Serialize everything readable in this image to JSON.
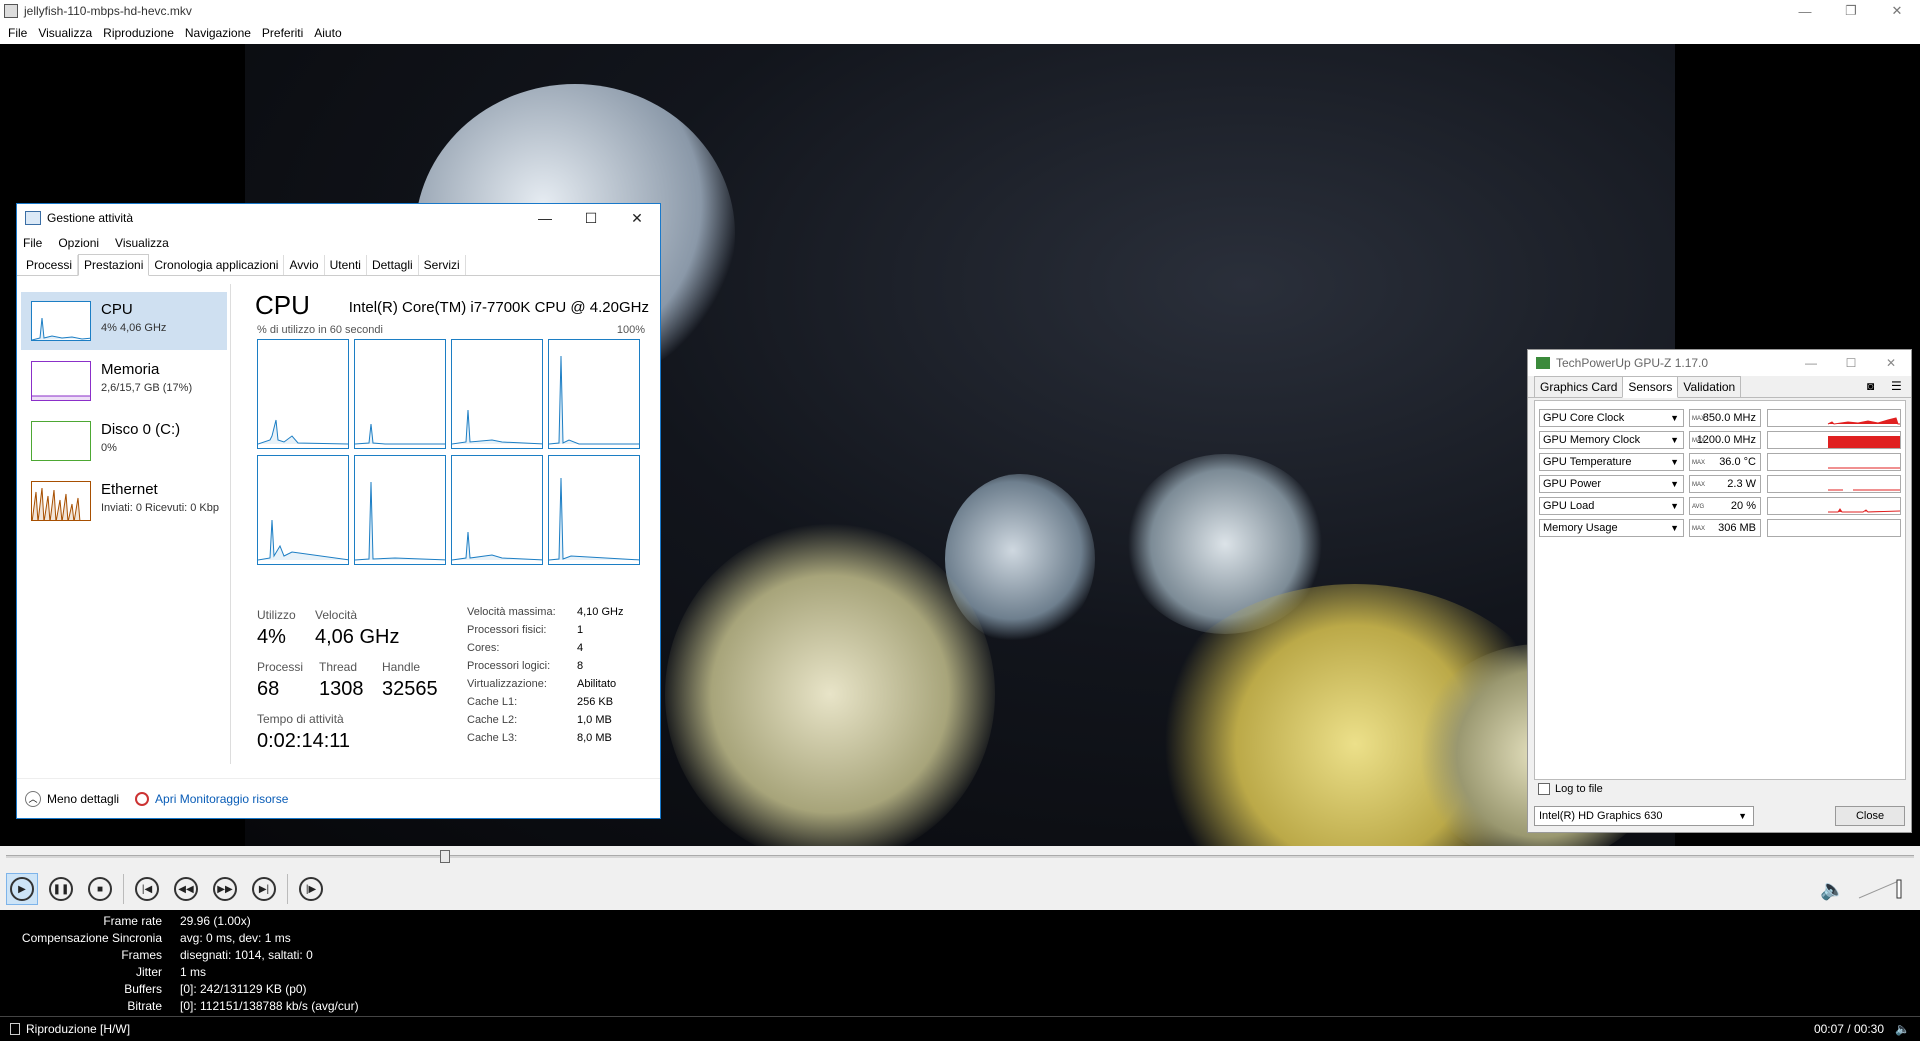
{
  "player": {
    "title": "jellyfish-110-mbps-hd-hevc.mkv",
    "menu": [
      "File",
      "Visualizza",
      "Riproduzione",
      "Navigazione",
      "Preferiti",
      "Aiuto"
    ],
    "seek_progress": 0.23,
    "stats": [
      {
        "label": "Frame rate",
        "value": "29.96 (1.00x)"
      },
      {
        "label": "Compensazione Sincronia",
        "value": "avg: 0 ms, dev: 1 ms"
      },
      {
        "label": "Frames",
        "value": "disegnati: 1014, saltati: 0"
      },
      {
        "label": "Jitter",
        "value": "1 ms"
      },
      {
        "label": "Buffers",
        "value": "[0]: 242/131129 KB (p0)"
      },
      {
        "label": "Bitrate",
        "value": "[0]: 112151/138788 kb/s (avg/cur)"
      }
    ],
    "status_left": "Riproduzione [H/W]",
    "status_time": "00:07 / 00:30"
  },
  "taskmgr": {
    "title": "Gestione attività",
    "menu": [
      "File",
      "Opzioni",
      "Visualizza"
    ],
    "tabs": [
      "Processi",
      "Prestazioni",
      "Cronologia applicazioni",
      "Avvio",
      "Utenti",
      "Dettagli",
      "Servizi"
    ],
    "side": [
      {
        "name": "CPU",
        "sub": "4% 4,06 GHz",
        "color": "#1c7ec4"
      },
      {
        "name": "Memoria",
        "sub": "2,6/15,7 GB (17%)",
        "color": "#8b2fc9"
      },
      {
        "name": "Disco 0 (C:)",
        "sub": "0%",
        "color": "#4da833"
      },
      {
        "name": "Ethernet",
        "sub": "Inviati: 0 Ricevuti: 0 Kbp",
        "color": "#a74f01"
      }
    ],
    "cpu_heading": "CPU",
    "cpu_model": "Intel(R) Core(TM) i7-7700K CPU @ 4.20GHz",
    "util_label": "% di utilizzo in 60 secondi",
    "util_max": "100%",
    "stats": {
      "utilizzo_label": "Utilizzo",
      "utilizzo": "4%",
      "velocita_label": "Velocità",
      "velocita": "4,06 GHz",
      "processi_label": "Processi",
      "processi": "68",
      "thread_label": "Thread",
      "thread": "1308",
      "handle_label": "Handle",
      "handle": "32565",
      "uptime_label": "Tempo di attività",
      "uptime": "0:02:14:11"
    },
    "details": [
      {
        "k": "Velocità massima:",
        "v": "4,10 GHz"
      },
      {
        "k": "Processori fisici:",
        "v": "1"
      },
      {
        "k": "Cores:",
        "v": "4"
      },
      {
        "k": "Processori logici:",
        "v": "8"
      },
      {
        "k": "Virtualizzazione:",
        "v": "Abilitato"
      },
      {
        "k": "Cache L1:",
        "v": "256 KB"
      },
      {
        "k": "Cache L2:",
        "v": "1,0 MB"
      },
      {
        "k": "Cache L3:",
        "v": "8,0 MB"
      }
    ],
    "less_details": "Meno dettagli",
    "resource_monitor": "Apri Monitoraggio risorse"
  },
  "gpuz": {
    "title": "TechPowerUp GPU-Z 1.17.0",
    "tabs": [
      "Graphics Card",
      "Sensors",
      "Validation"
    ],
    "sensors": [
      {
        "name": "GPU Core Clock",
        "tag": "MAX",
        "value": "850.0 MHz"
      },
      {
        "name": "GPU Memory Clock",
        "tag": "MAX",
        "value": "1200.0 MHz"
      },
      {
        "name": "GPU Temperature",
        "tag": "MAX",
        "value": "36.0 °C"
      },
      {
        "name": "GPU Power",
        "tag": "MAX",
        "value": "2.3 W"
      },
      {
        "name": "GPU Load",
        "tag": "AVG",
        "value": "20 %"
      },
      {
        "name": "Memory Usage",
        "tag": "MAX",
        "value": "306 MB"
      }
    ],
    "log_label": "Log to file",
    "adapter": "Intel(R) HD Graphics 630",
    "close_label": "Close",
    "graph_color": "#e02020"
  }
}
